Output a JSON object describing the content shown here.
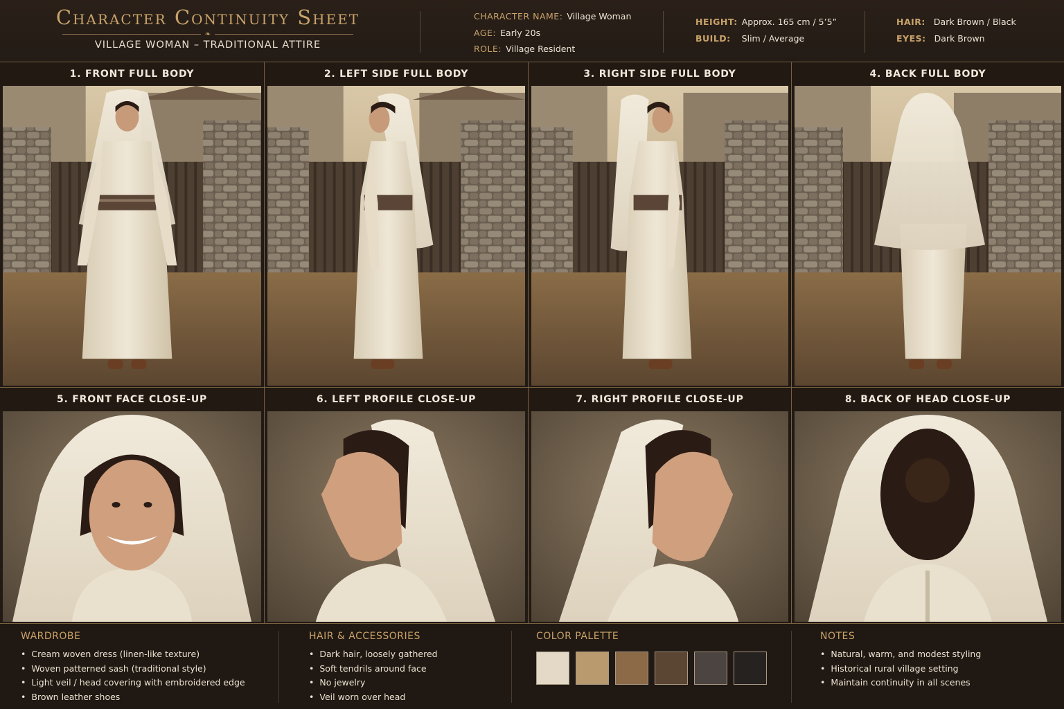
{
  "header": {
    "title": "Character Continuity Sheet",
    "subtitle": "VILLAGE WOMAN – TRADITIONAL ATTIRE",
    "info": [
      {
        "key": "CHARACTER NAME:",
        "value": "Village Woman"
      },
      {
        "key": "AGE:",
        "value": "Early 20s"
      },
      {
        "key": "ROLE:",
        "value": "Village Resident"
      },
      {
        "key": "HEIGHT:",
        "value": "Approx. 165 cm / 5’5”"
      },
      {
        "key": "BUILD:",
        "value": "Slim / Average"
      },
      {
        "key": "HAIR:",
        "value": "Dark Brown / Black"
      },
      {
        "key": "EYES:",
        "value": "Dark Brown"
      }
    ]
  },
  "panels": [
    {
      "label": "1. FRONT FULL BODY"
    },
    {
      "label": "2. LEFT SIDE FULL BODY"
    },
    {
      "label": "3. RIGHT SIDE FULL BODY"
    },
    {
      "label": "4. BACK FULL BODY"
    },
    {
      "label": "5. FRONT FACE CLOSE-UP"
    },
    {
      "label": "6. LEFT PROFILE CLOSE-UP"
    },
    {
      "label": "7. RIGHT PROFILE CLOSE-UP"
    },
    {
      "label": "8. BACK OF HEAD CLOSE-UP"
    }
  ],
  "footer": {
    "wardrobe": {
      "heading": "WARDROBE",
      "items": [
        "Cream woven dress (linen-like texture)",
        "Woven patterned sash (traditional style)",
        "Light veil / head covering with embroidered edge",
        "Brown leather shoes"
      ]
    },
    "hair": {
      "heading": "HAIR & ACCESSORIES",
      "items": [
        "Dark hair, loosely gathered",
        "Soft tendrils around face",
        "No jewelry",
        "Veil worn over head"
      ]
    },
    "palette": {
      "heading": "COLOR PALETTE",
      "colors": [
        "#e3d9c6",
        "#b99a6e",
        "#8c6a48",
        "#5b4634",
        "#4c4440",
        "#262220"
      ]
    },
    "notes": {
      "heading": "NOTES",
      "items": [
        "Natural, warm, and modest styling",
        "Historical rural village setting",
        "Maintain continuity in all scenes"
      ]
    }
  },
  "colors": {
    "accent": "#c9a36a",
    "background": "#221a14",
    "border": "#7a6142"
  }
}
